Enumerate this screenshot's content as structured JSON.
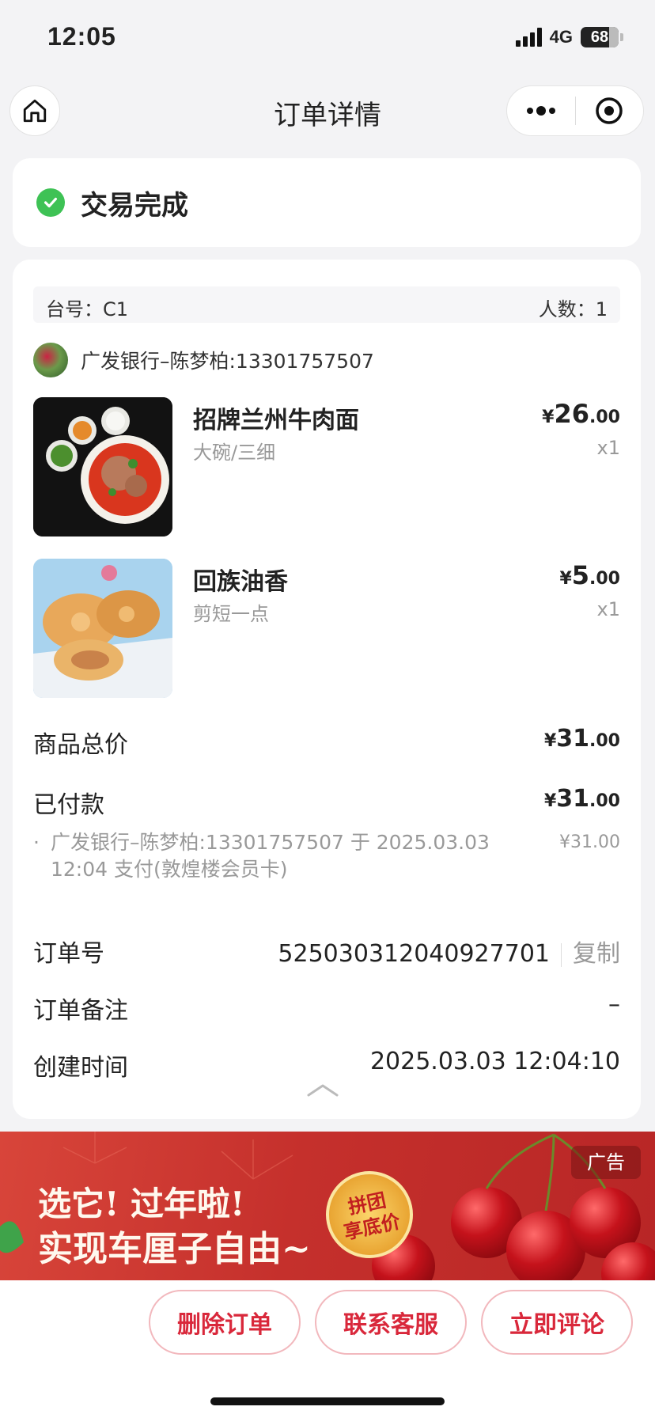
{
  "status_bar": {
    "time": "12:05",
    "network": "4G",
    "battery": "68"
  },
  "nav": {
    "title": "订单详情"
  },
  "order_status": {
    "text": "交易完成"
  },
  "table": {
    "table_label": "台号：C1",
    "people_label": "人数：1"
  },
  "customer": {
    "name": "广发银行–陈梦柏:13301757507"
  },
  "items": [
    {
      "name": "招牌兰州牛肉面",
      "spec": "大碗/三细",
      "price_yen": "¥",
      "price_int": "26",
      "price_dec": ".00",
      "qty": "x1"
    },
    {
      "name": "回族油香",
      "spec": "剪短一点",
      "price_yen": "¥",
      "price_int": "5",
      "price_dec": ".00",
      "qty": "x1"
    }
  ],
  "summary": {
    "total_label": "商品总价",
    "total_yen": "¥",
    "total_int": "31",
    "total_dec": ".00",
    "paid_label": "已付款",
    "paid_yen": "¥",
    "paid_int": "31",
    "paid_dec": ".00",
    "payment_detail_bullet": "·",
    "payment_detail": "广发银行–陈梦柏:13301757507 于 2025.03.03 12:04 支付(敦煌楼会员卡)",
    "payment_detail_amount": "¥31.00",
    "order_no_label": "订单号",
    "order_no": "525030312040927701",
    "copy_label": "复制",
    "remark_label": "订单备注",
    "remark": "–",
    "created_label": "创建时间",
    "created": "2025.03.03 12:04:10"
  },
  "ad": {
    "line1": "选它! 过年啦!",
    "line2": "实现车厘子自由~",
    "badge_line1": "拼团",
    "badge_line2": "享底价",
    "tag": "广告"
  },
  "actions": {
    "delete": "删除订单",
    "contact": "联系客服",
    "review": "立即评论"
  },
  "colors": {
    "accent": "#d9283b",
    "success": "#3ec255"
  },
  "icons": {
    "home": "home-icon",
    "more": "more-dots-icon",
    "close": "target-close-icon",
    "check": "check-circle-icon",
    "collapse": "chevron-up-icon"
  }
}
